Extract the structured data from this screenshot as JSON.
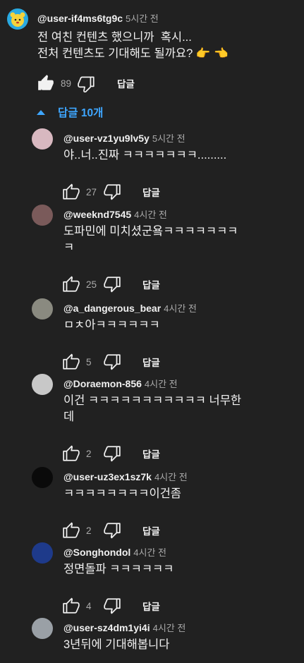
{
  "top_comment": {
    "author": "@user-if4ms6tg9c",
    "time": "5시간 전",
    "text": "전 여친 컨텐츠 했으니까  혹시...\n전처 컨텐츠도 기대해도 될까요? 👉 👈",
    "likes": "89",
    "reply_label": "답글",
    "avatar_color": "#29a9e1"
  },
  "replies_toggle": {
    "label": "답글 10개",
    "icon": "caret-up-icon",
    "color": "#3ea6ff"
  },
  "replies": [
    {
      "author": "@user-vz1yu9lv5y",
      "time": "5시간 전",
      "text": "야..너..진짜 ㅋㅋㅋㅋㅋㅋㅋ.........",
      "likes": "27",
      "reply_label": "답글",
      "avatar_color": "#d8b8c0"
    },
    {
      "author": "@weeknd7545",
      "time": "4시간 전",
      "text": "도파민에 미치셨군욬ㅋㅋㅋㅋㅋㅋㅋ\nㅋ",
      "likes": "25",
      "reply_label": "답글",
      "avatar_color": "#7a5a5a"
    },
    {
      "author": "@a_dangerous_bear",
      "time": "4시간 전",
      "text": "ㅁㅊ아ㅋㅋㅋㅋㅋㅋ",
      "likes": "5",
      "reply_label": "답글",
      "avatar_color": "#8a8a80"
    },
    {
      "author": "@Doraemon-856",
      "time": "4시간 전",
      "text": "이건 ㅋㅋㅋㅋㅋㅋㅋㅋㅋㅋㅋ 너무한\n데",
      "likes": "2",
      "reply_label": "답글",
      "avatar_color": "#c8c8c8"
    },
    {
      "author": "@user-uz3ex1sz7k",
      "time": "4시간 전",
      "text": "ㅋㅋㅋㅋㅋㅋㅋㅋ이건좀",
      "likes": "2",
      "reply_label": "답글",
      "avatar_color": "#0a0a0a"
    },
    {
      "author": "@Songhondol",
      "time": "4시간 전",
      "text": "정면돌파 ㅋㅋㅋㅋㅋㅋ",
      "likes": "4",
      "reply_label": "답글",
      "avatar_color": "#1e3a8a"
    },
    {
      "author": "@user-sz4dm1yi4i",
      "time": "4시간 전",
      "text": "3년뒤에 기대해봅니다",
      "likes": "",
      "reply_label": "",
      "avatar_color": "#9aa0a6"
    }
  ],
  "colors": {
    "background": "#212121",
    "text": "#f1f1f1",
    "secondary": "#aaaaaa",
    "accent": "#3ea6ff"
  }
}
